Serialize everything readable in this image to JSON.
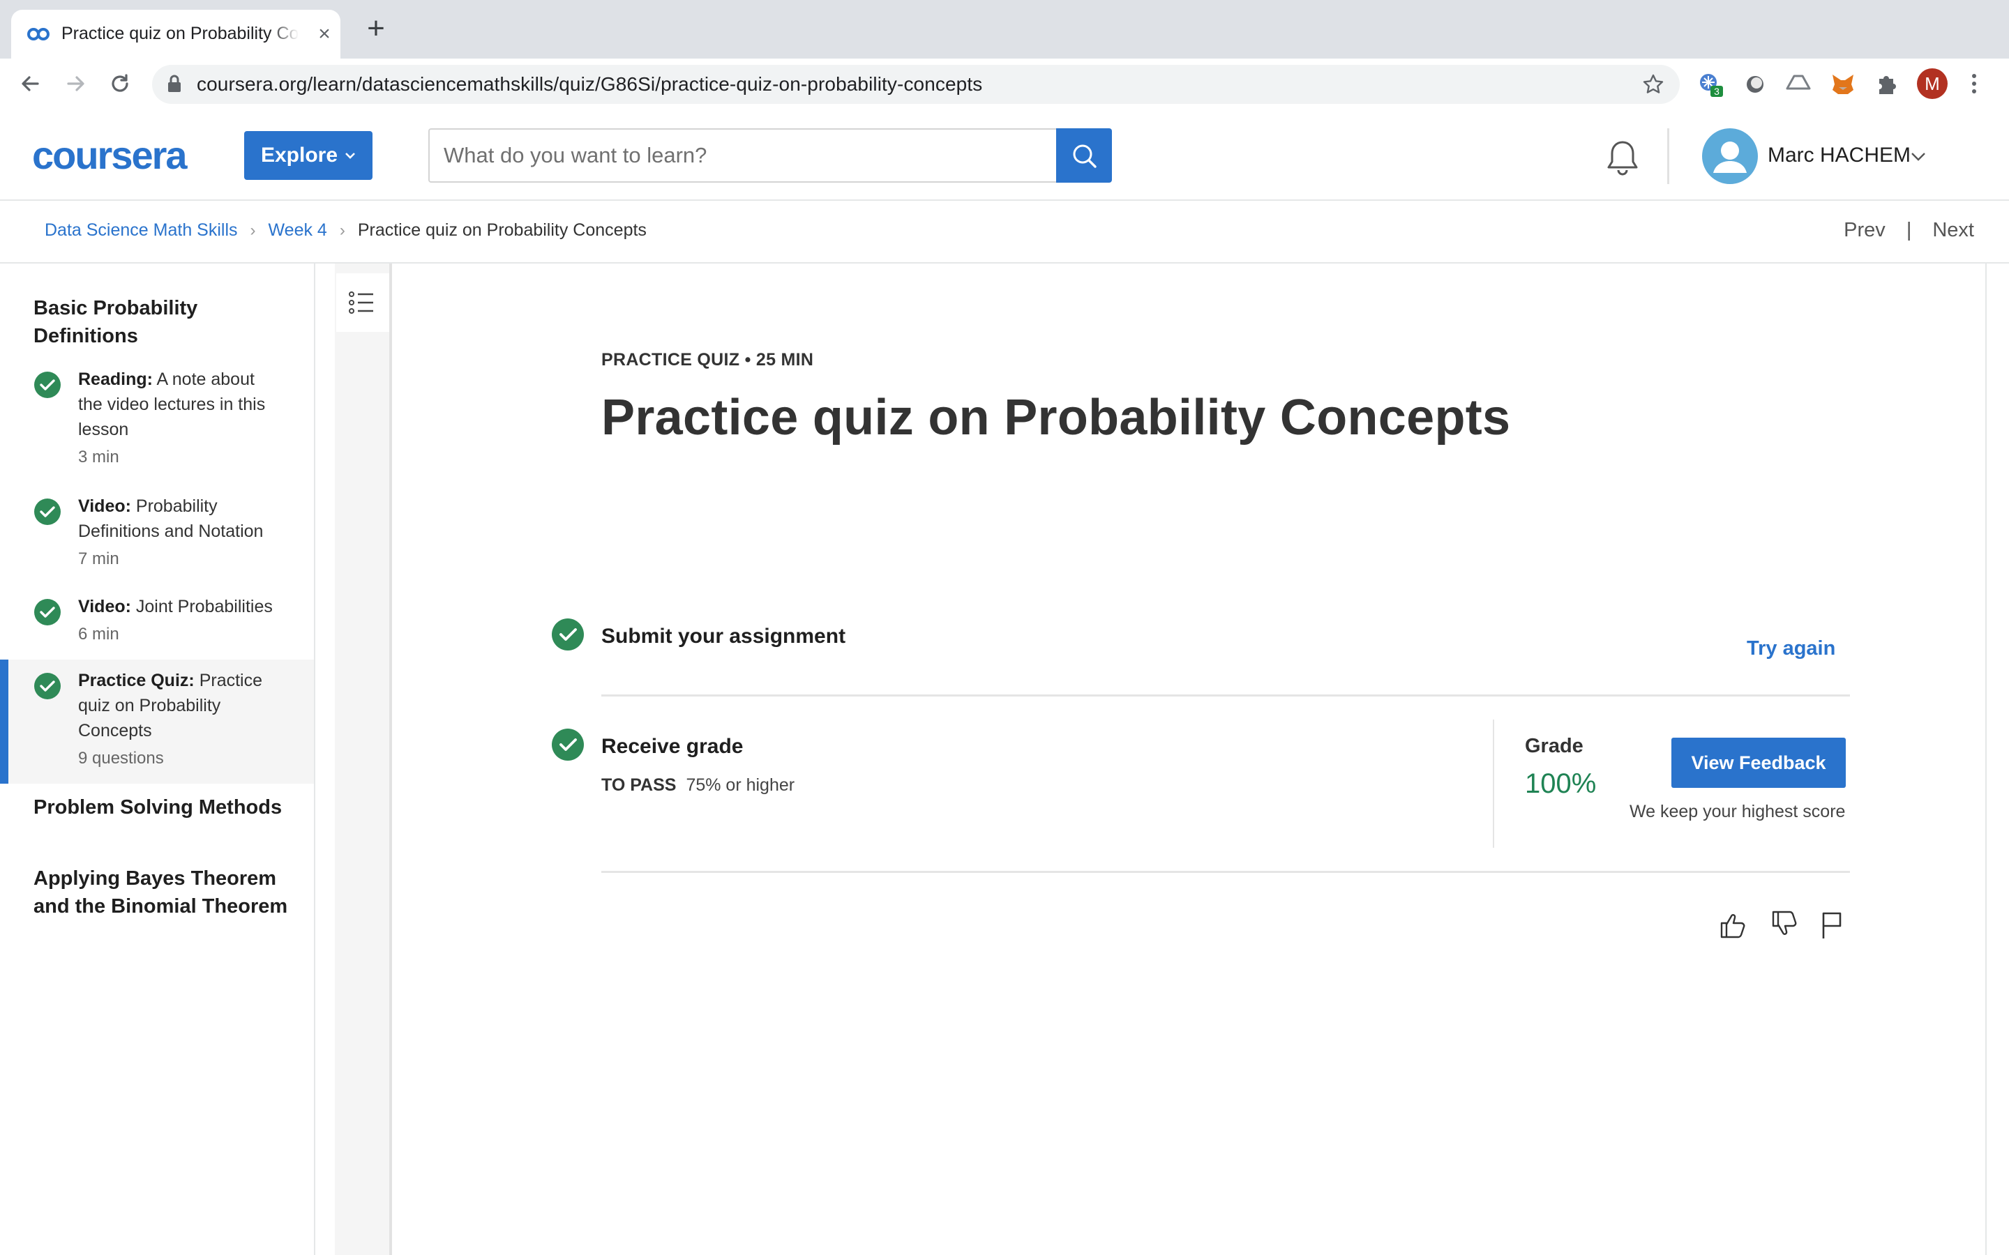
{
  "browser": {
    "tab_title": "Practice quiz on Probability Concepts",
    "tab_close": "×",
    "new_tab": "+",
    "url": "coursera.org/learn/datasciencemathskills/quiz/G86Si/practice-quiz-on-probability-concepts",
    "extension_badge": "3",
    "profile_initial": "M"
  },
  "header": {
    "explore_label": "Explore",
    "search_placeholder": "What do you want to learn?",
    "user_name": "Marc HACHEM"
  },
  "breadcrumb": {
    "course": "Data Science Math Skills",
    "week": "Week 4",
    "current": "Practice quiz on Probability Concepts",
    "prev": "Prev",
    "next": "Next",
    "sep": "›",
    "divider": "|"
  },
  "sidebar": {
    "sections": [
      {
        "title": "Basic Probability Definitions"
      },
      {
        "title": "Problem Solving Methods"
      },
      {
        "title": "Applying Bayes Theorem and the Binomial Theorem"
      }
    ],
    "items": [
      {
        "type": "Reading:",
        "title": "A note about the video lectures in this lesson",
        "meta": "3 min",
        "completed": true,
        "active": false
      },
      {
        "type": "Video:",
        "title": "Probability Definitions and Notation",
        "meta": "7 min",
        "completed": true,
        "active": false
      },
      {
        "type": "Video:",
        "title": "Joint Probabilities",
        "meta": "6 min",
        "completed": true,
        "active": false
      },
      {
        "type": "Practice Quiz:",
        "title": "Practice quiz on Probability Concepts",
        "meta": "9 questions",
        "completed": true,
        "active": true
      }
    ]
  },
  "main": {
    "kicker": "PRACTICE QUIZ • 25 MIN",
    "title": "Practice quiz on Probability Concepts",
    "submit_title": "Submit your assignment",
    "try_again": "Try again",
    "receive_title": "Receive grade",
    "to_pass_label": "TO PASS",
    "to_pass_value": "75% or higher",
    "grade_label": "Grade",
    "grade_value": "100%",
    "feedback_button": "View Feedback",
    "keep_note": "We keep your highest score"
  },
  "colors": {
    "brand_blue": "#2a73cc",
    "success_green": "#1f8354",
    "check_green": "#2f8a57"
  },
  "icons": [
    "coursera-favicon-icon",
    "back-icon",
    "forward-icon",
    "reload-icon",
    "lock-icon",
    "star-icon",
    "puzzle-icon",
    "bell-icon",
    "search-icon",
    "user-icon",
    "chevron-down-icon",
    "list-icon",
    "check-circle-icon",
    "thumbs-up-icon",
    "thumbs-down-icon",
    "flag-icon"
  ]
}
